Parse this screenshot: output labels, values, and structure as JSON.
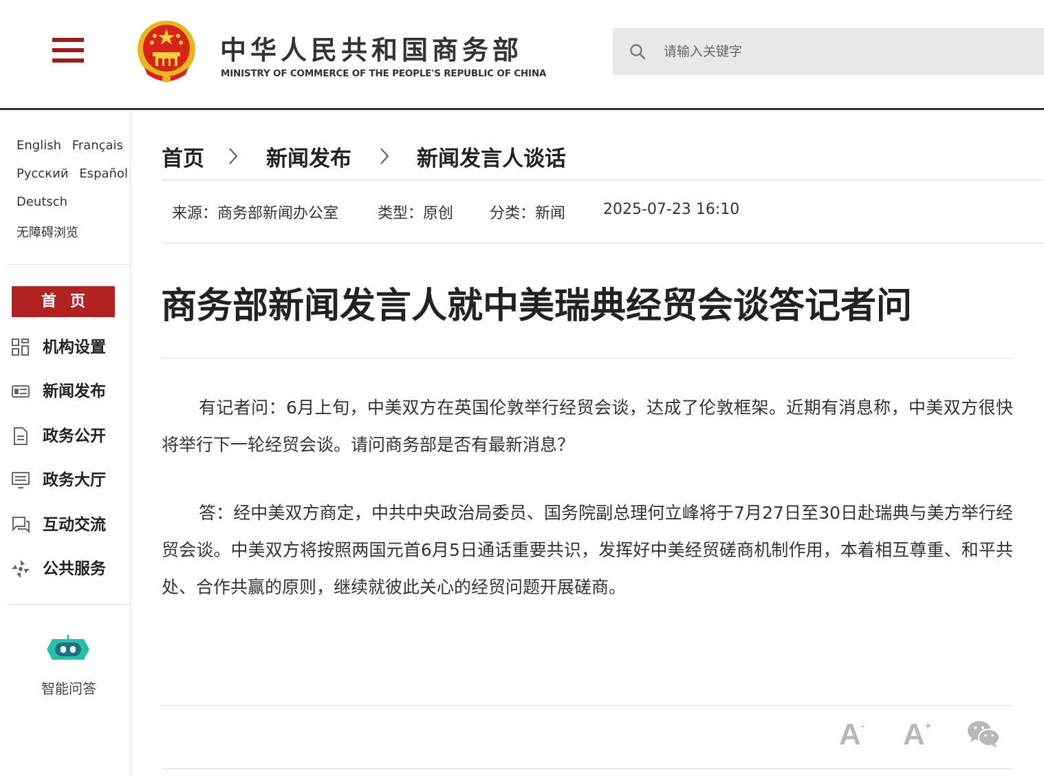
{
  "header": {
    "title_cn": "中华人民共和国商务部",
    "title_en": "MINISTRY OF COMMERCE OF THE PEOPLE'S REPUBLIC OF CHINA",
    "search_placeholder": "请输入关键字",
    "brand_color": "#b22222"
  },
  "sidebar": {
    "languages": {
      "english": "English",
      "french": "Français",
      "russian": "Русский",
      "spanish": "Español",
      "german": "Deutsch",
      "accessible": "无障碍浏览"
    },
    "home": "首页",
    "nav": [
      {
        "label": "机构设置",
        "icon": "grid-icon"
      },
      {
        "label": "新闻发布",
        "icon": "news-icon"
      },
      {
        "label": "政务公开",
        "icon": "document-icon"
      },
      {
        "label": "政务大厅",
        "icon": "monitor-icon"
      },
      {
        "label": "互动交流",
        "icon": "chat-icon"
      },
      {
        "label": "公共服务",
        "icon": "service-icon"
      }
    ],
    "assistant_label": "智能问答"
  },
  "breadcrumb": [
    "首页",
    "新闻发布",
    "新闻发言人谈话"
  ],
  "meta": {
    "source": "来源：商务部新闻办公室",
    "type": "类型：原创",
    "category": "分类：新闻",
    "datetime": "2025-07-23 16:10"
  },
  "article": {
    "title": "商务部新闻发言人就中美瑞典经贸会谈答记者问",
    "paragraphs": [
      "有记者问：6月上旬，中美双方在英国伦敦举行经贸会谈，达成了伦敦框架。近期有消息称，中美双方很快将举行下一轮经贸会谈。请问商务部是否有最新消息？",
      "答：经中美双方商定，中共中央政治局委员、国务院副总理何立峰将于7月27日至30日赴瑞典与美方举行经贸会谈。中美双方将按照两国元首6月5日通话重要共识，发挥好中美经贸磋商机制作用，本着相互尊重、和平共处、合作共赢的原则，继续就彼此关心的经贸问题开展磋商。"
    ]
  },
  "toolbar": {
    "font_smaller": "A",
    "font_smaller_sign": "-",
    "font_larger": "A",
    "font_larger_sign": "+",
    "share_icon": "wechat-icon"
  }
}
